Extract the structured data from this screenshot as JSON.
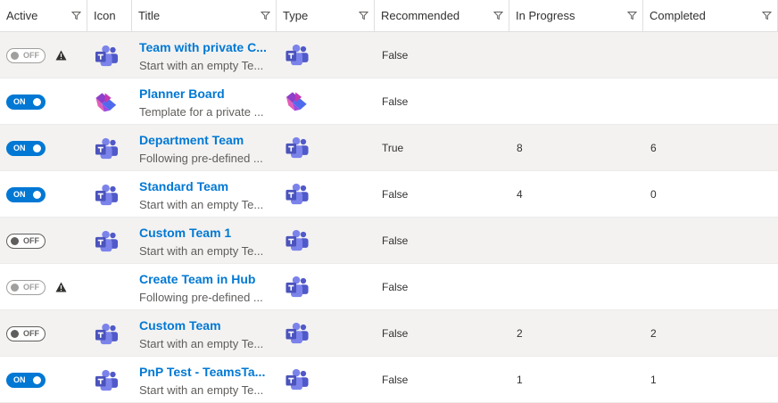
{
  "columns": [
    "Active",
    "Icon",
    "Title",
    "Type",
    "Recommended",
    "In Progress",
    "Completed"
  ],
  "toggle_text": {
    "on": "ON",
    "off": "OFF"
  },
  "rows": [
    {
      "active": false,
      "disabled": true,
      "warning": true,
      "icon": "teams-icon",
      "title": "Team with private C...",
      "description": "Start with an empty Te...",
      "type_icon": "teams-icon",
      "recommended": "False",
      "in_progress": "",
      "completed": ""
    },
    {
      "active": true,
      "disabled": false,
      "warning": false,
      "icon": "planner-icon",
      "title": "Planner Board",
      "description": "Template for a private ...",
      "type_icon": "planner-icon",
      "recommended": "False",
      "in_progress": "",
      "completed": ""
    },
    {
      "active": true,
      "disabled": false,
      "warning": false,
      "icon": "teams-icon",
      "title": "Department Team",
      "description": "Following pre-defined ...",
      "type_icon": "teams-icon",
      "recommended": "True",
      "in_progress": "8",
      "completed": "6"
    },
    {
      "active": true,
      "disabled": false,
      "warning": false,
      "icon": "teams-icon",
      "title": "Standard Team",
      "description": "Start with an empty Te...",
      "type_icon": "teams-icon",
      "recommended": "False",
      "in_progress": "4",
      "completed": "0"
    },
    {
      "active": false,
      "disabled": false,
      "warning": false,
      "icon": "teams-icon",
      "title": "Custom Team 1",
      "description": "Start with an empty Te...",
      "type_icon": "teams-icon",
      "recommended": "False",
      "in_progress": "",
      "completed": ""
    },
    {
      "active": false,
      "disabled": true,
      "warning": true,
      "icon": "",
      "title": "Create Team in Hub",
      "description": "Following pre-defined ...",
      "type_icon": "teams-icon",
      "recommended": "False",
      "in_progress": "",
      "completed": ""
    },
    {
      "active": false,
      "disabled": false,
      "warning": false,
      "icon": "teams-icon",
      "title": "Custom Team",
      "description": "Start with an empty Te...",
      "type_icon": "teams-icon",
      "recommended": "False",
      "in_progress": "2",
      "completed": "2"
    },
    {
      "active": true,
      "disabled": false,
      "warning": false,
      "icon": "teams-icon",
      "title": "PnP Test - TeamsTa...",
      "description": "Start with an empty Te...",
      "type_icon": "teams-icon",
      "recommended": "False",
      "in_progress": "1",
      "completed": "1"
    }
  ],
  "colors": {
    "accent": "#0078d4",
    "alt_row": "#f3f2f1",
    "teams_purple": "#5b5fc7",
    "planner_pink": "#c239b3"
  }
}
